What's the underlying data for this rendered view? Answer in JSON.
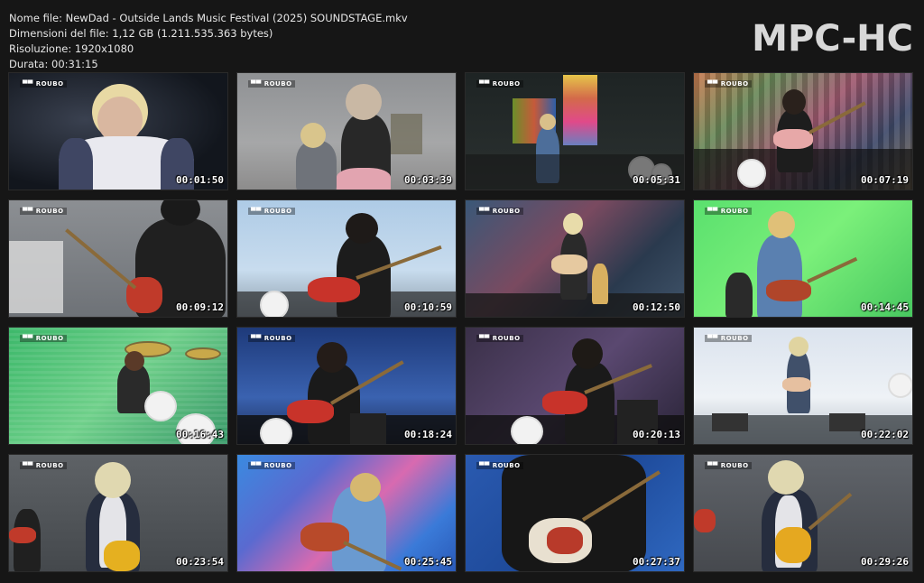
{
  "info": {
    "filename": "Nome file: NewDad - Outside Lands Music Festival (2025) SOUNDSTAGE.mkv",
    "filesize": "Dimensioni del file: 1,12 GB (1.211.535.363 bytes)",
    "resolution": "Risoluzione: 1920x1080",
    "duration": "Durata: 00:31:15"
  },
  "brand": "MPC-HC",
  "thumbnails": [
    {
      "time": "00:01:50",
      "scene": "closeup-singer-dark"
    },
    {
      "time": "00:03:39",
      "scene": "hazy-stage"
    },
    {
      "time": "00:05:31",
      "scene": "wide-stage-screen"
    },
    {
      "time": "00:07:19",
      "scene": "bassist-glitch-screen"
    },
    {
      "time": "00:09:12",
      "scene": "bassist-closeup-grey"
    },
    {
      "time": "00:10:59",
      "scene": "bassist-lightblue"
    },
    {
      "time": "00:12:50",
      "scene": "singer-guitar-wide"
    },
    {
      "time": "00:14:45",
      "scene": "guitarist-green"
    },
    {
      "time": "00:16:43",
      "scene": "drummer-green"
    },
    {
      "time": "00:18:24",
      "scene": "bassist-blue-screen"
    },
    {
      "time": "00:20:13",
      "scene": "bassist-purple"
    },
    {
      "time": "00:22:02",
      "scene": "wide-stage-white"
    },
    {
      "time": "00:23:54",
      "scene": "singer-mic-grey"
    },
    {
      "time": "00:25:45",
      "scene": "guitarist-blue-pink"
    },
    {
      "time": "00:27:37",
      "scene": "guitar-closeup-blue"
    },
    {
      "time": "00:29:26",
      "scene": "singer-guitar-grey"
    }
  ]
}
